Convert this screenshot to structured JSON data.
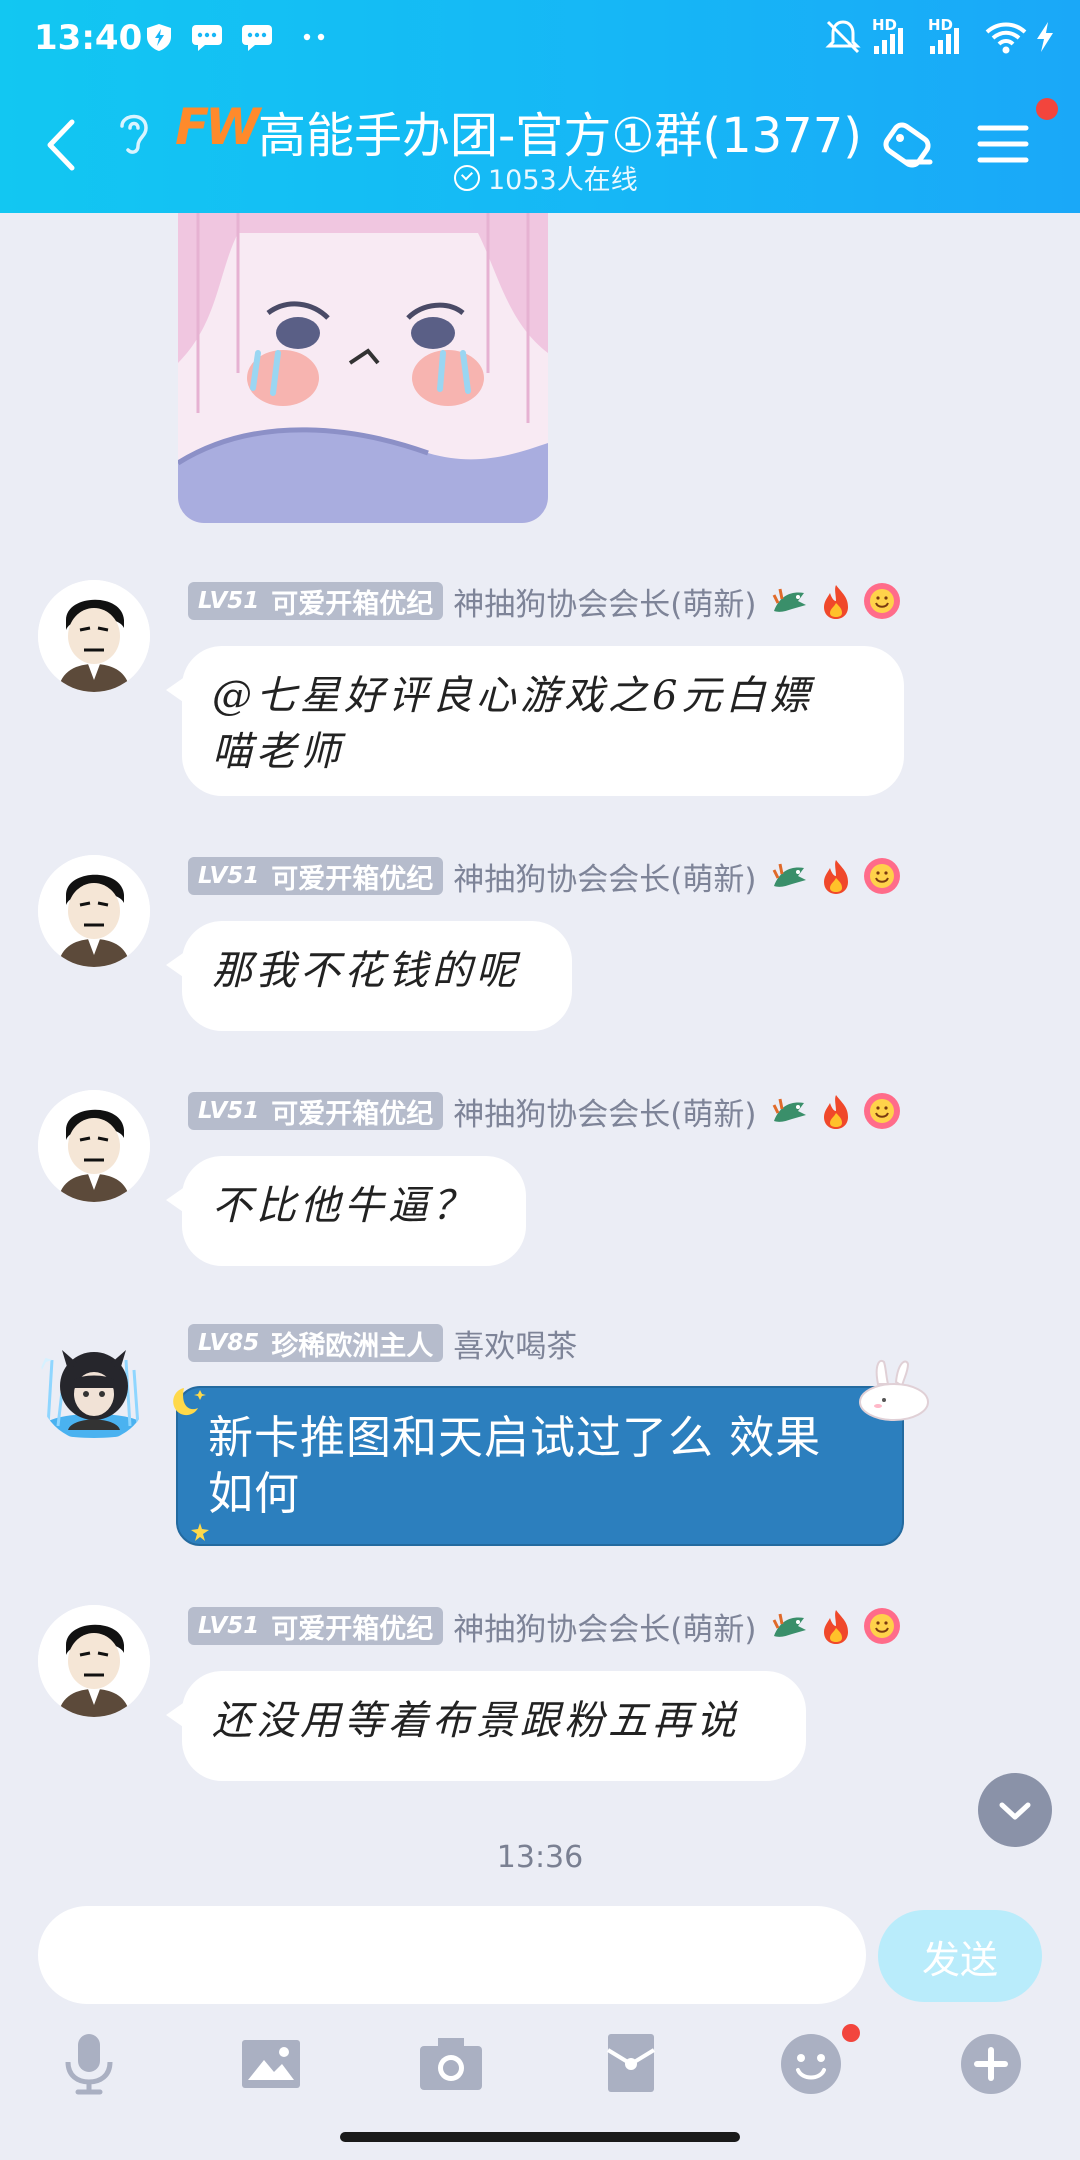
{
  "status_bar": {
    "time": "13:40",
    "hd_label_1": "HD",
    "hd_label_2": "HD"
  },
  "header": {
    "logo_text": "FW",
    "group_title": "高能手办团-官方①群(1377)",
    "online_status": "1053人在线"
  },
  "messages": [
    {
      "level": "LV51",
      "name": "可爱开箱优纪",
      "honor": "神抽狗协会会长(萌新)",
      "text_line1": "@七星好评良心游戏之6元白嫖",
      "text_line2": "喵老师"
    },
    {
      "level": "LV51",
      "name": "可爱开箱优纪",
      "honor": "神抽狗协会会长(萌新)",
      "text": "那我不花钱的呢"
    },
    {
      "level": "LV51",
      "name": "可爱开箱优纪",
      "honor": "神抽狗协会会长(萌新)",
      "text": "不比他牛逼？"
    },
    {
      "level": "LV85",
      "name": "珍稀欧洲主人",
      "honor": "喜欢喝茶",
      "text_line1": "新卡推图和天启试过了么  效果",
      "text_line2": "如何"
    },
    {
      "level": "LV51",
      "name": "可爱开箱优纪",
      "honor": "神抽狗协会会长(萌新)",
      "text": "还没用等着布景跟粉五再说"
    }
  ],
  "timestamp": "13:36",
  "composer": {
    "input_value": "",
    "send_label": "发送"
  },
  "colors": {
    "header_accent": "#16b6f6",
    "chat_background": "#ebedf5",
    "highlight_bubble": "#2c7fbe",
    "notification_dot": "#f2453d"
  }
}
